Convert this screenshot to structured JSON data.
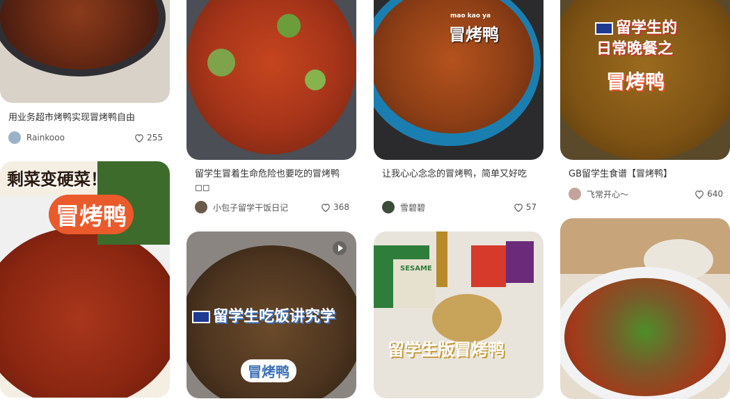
{
  "colors": {
    "accent": "#ff2442",
    "text": "#333333",
    "muted": "#555555"
  },
  "cards": [
    {
      "title": "用业务超市烤鸭实现冒烤鸭自由",
      "author": "Rainkooo",
      "likes": "255",
      "overlay": ""
    },
    {
      "title": "留学生冒着生命危险也要吃的冒烤鸭◻︎◻︎",
      "author": "小包子留学干饭日记",
      "likes": "368",
      "overlay": ""
    },
    {
      "title": "让我心心念念的冒烤鸭，简单又好吃",
      "author": "雪碧碧",
      "likes": "57",
      "overlay": "冒烤鸭",
      "overlay_small": "mao  kao  ya"
    },
    {
      "title": "GB留学生食谱【冒烤鸭】",
      "author": "飞常开心～",
      "likes": "640",
      "overlay_line1": "留学生的",
      "overlay_line2": "日常晚餐之",
      "overlay_line3": "冒烤鸭"
    },
    {
      "overlay_line1": "剩菜变硬菜！",
      "overlay_line2": "冒烤鸭"
    },
    {
      "overlay_line1": "留学生吃饭讲究学",
      "overlay_line2": "冒烤鸭"
    },
    {
      "overlay_line1": "留学生版冒烤鸭",
      "overlay_line2": "SESAME"
    },
    {
      "overlay": ""
    }
  ]
}
